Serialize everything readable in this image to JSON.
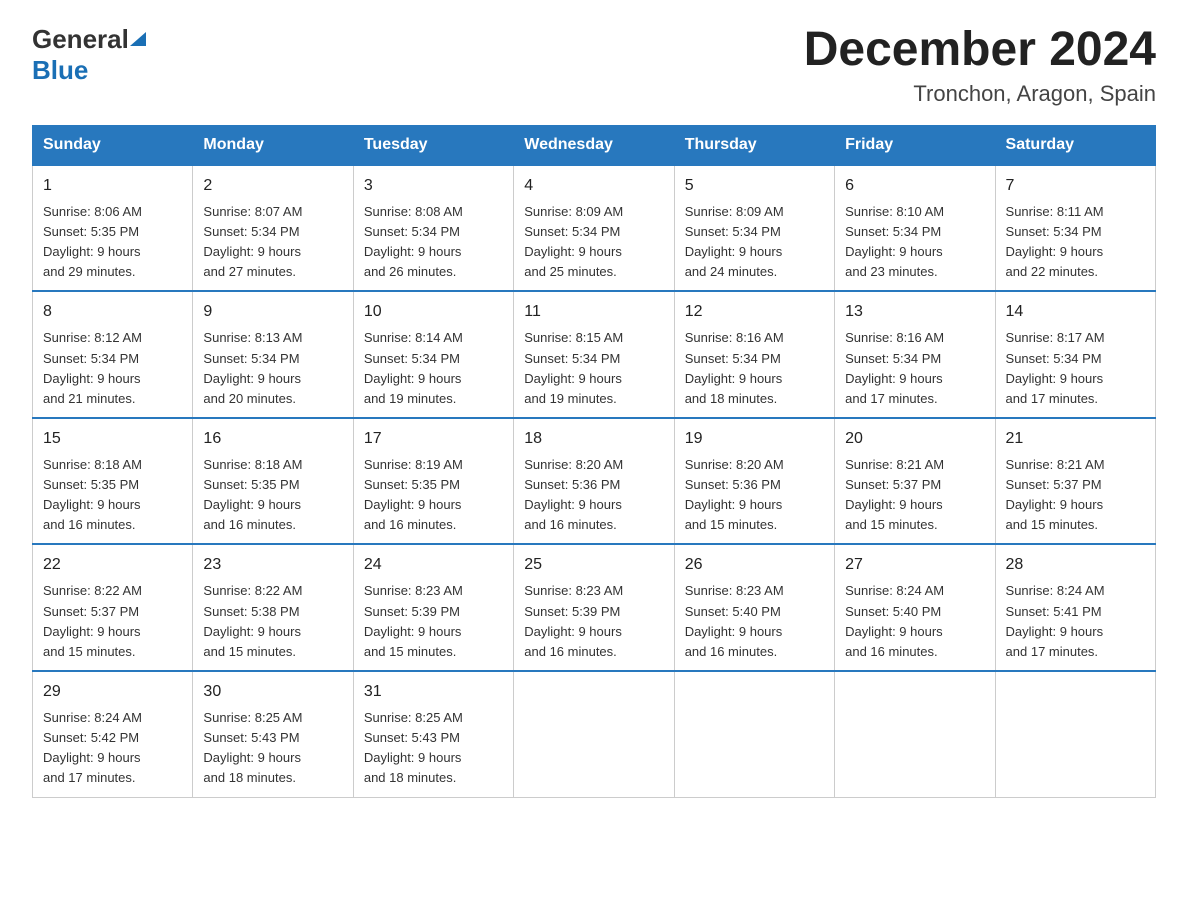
{
  "header": {
    "logo": {
      "general": "General",
      "blue": "Blue"
    },
    "title": "December 2024",
    "subtitle": "Tronchon, Aragon, Spain"
  },
  "days_of_week": [
    "Sunday",
    "Monday",
    "Tuesday",
    "Wednesday",
    "Thursday",
    "Friday",
    "Saturday"
  ],
  "weeks": [
    [
      {
        "day": "1",
        "sunrise": "8:06 AM",
        "sunset": "5:35 PM",
        "daylight": "9 hours and 29 minutes."
      },
      {
        "day": "2",
        "sunrise": "8:07 AM",
        "sunset": "5:34 PM",
        "daylight": "9 hours and 27 minutes."
      },
      {
        "day": "3",
        "sunrise": "8:08 AM",
        "sunset": "5:34 PM",
        "daylight": "9 hours and 26 minutes."
      },
      {
        "day": "4",
        "sunrise": "8:09 AM",
        "sunset": "5:34 PM",
        "daylight": "9 hours and 25 minutes."
      },
      {
        "day": "5",
        "sunrise": "8:09 AM",
        "sunset": "5:34 PM",
        "daylight": "9 hours and 24 minutes."
      },
      {
        "day": "6",
        "sunrise": "8:10 AM",
        "sunset": "5:34 PM",
        "daylight": "9 hours and 23 minutes."
      },
      {
        "day": "7",
        "sunrise": "8:11 AM",
        "sunset": "5:34 PM",
        "daylight": "9 hours and 22 minutes."
      }
    ],
    [
      {
        "day": "8",
        "sunrise": "8:12 AM",
        "sunset": "5:34 PM",
        "daylight": "9 hours and 21 minutes."
      },
      {
        "day": "9",
        "sunrise": "8:13 AM",
        "sunset": "5:34 PM",
        "daylight": "9 hours and 20 minutes."
      },
      {
        "day": "10",
        "sunrise": "8:14 AM",
        "sunset": "5:34 PM",
        "daylight": "9 hours and 19 minutes."
      },
      {
        "day": "11",
        "sunrise": "8:15 AM",
        "sunset": "5:34 PM",
        "daylight": "9 hours and 19 minutes."
      },
      {
        "day": "12",
        "sunrise": "8:16 AM",
        "sunset": "5:34 PM",
        "daylight": "9 hours and 18 minutes."
      },
      {
        "day": "13",
        "sunrise": "8:16 AM",
        "sunset": "5:34 PM",
        "daylight": "9 hours and 17 minutes."
      },
      {
        "day": "14",
        "sunrise": "8:17 AM",
        "sunset": "5:34 PM",
        "daylight": "9 hours and 17 minutes."
      }
    ],
    [
      {
        "day": "15",
        "sunrise": "8:18 AM",
        "sunset": "5:35 PM",
        "daylight": "9 hours and 16 minutes."
      },
      {
        "day": "16",
        "sunrise": "8:18 AM",
        "sunset": "5:35 PM",
        "daylight": "9 hours and 16 minutes."
      },
      {
        "day": "17",
        "sunrise": "8:19 AM",
        "sunset": "5:35 PM",
        "daylight": "9 hours and 16 minutes."
      },
      {
        "day": "18",
        "sunrise": "8:20 AM",
        "sunset": "5:36 PM",
        "daylight": "9 hours and 16 minutes."
      },
      {
        "day": "19",
        "sunrise": "8:20 AM",
        "sunset": "5:36 PM",
        "daylight": "9 hours and 15 minutes."
      },
      {
        "day": "20",
        "sunrise": "8:21 AM",
        "sunset": "5:37 PM",
        "daylight": "9 hours and 15 minutes."
      },
      {
        "day": "21",
        "sunrise": "8:21 AM",
        "sunset": "5:37 PM",
        "daylight": "9 hours and 15 minutes."
      }
    ],
    [
      {
        "day": "22",
        "sunrise": "8:22 AM",
        "sunset": "5:37 PM",
        "daylight": "9 hours and 15 minutes."
      },
      {
        "day": "23",
        "sunrise": "8:22 AM",
        "sunset": "5:38 PM",
        "daylight": "9 hours and 15 minutes."
      },
      {
        "day": "24",
        "sunrise": "8:23 AM",
        "sunset": "5:39 PM",
        "daylight": "9 hours and 15 minutes."
      },
      {
        "day": "25",
        "sunrise": "8:23 AM",
        "sunset": "5:39 PM",
        "daylight": "9 hours and 16 minutes."
      },
      {
        "day": "26",
        "sunrise": "8:23 AM",
        "sunset": "5:40 PM",
        "daylight": "9 hours and 16 minutes."
      },
      {
        "day": "27",
        "sunrise": "8:24 AM",
        "sunset": "5:40 PM",
        "daylight": "9 hours and 16 minutes."
      },
      {
        "day": "28",
        "sunrise": "8:24 AM",
        "sunset": "5:41 PM",
        "daylight": "9 hours and 17 minutes."
      }
    ],
    [
      {
        "day": "29",
        "sunrise": "8:24 AM",
        "sunset": "5:42 PM",
        "daylight": "9 hours and 17 minutes."
      },
      {
        "day": "30",
        "sunrise": "8:25 AM",
        "sunset": "5:43 PM",
        "daylight": "9 hours and 18 minutes."
      },
      {
        "day": "31",
        "sunrise": "8:25 AM",
        "sunset": "5:43 PM",
        "daylight": "9 hours and 18 minutes."
      },
      null,
      null,
      null,
      null
    ]
  ],
  "labels": {
    "sunrise": "Sunrise:",
    "sunset": "Sunset:",
    "daylight": "Daylight:"
  }
}
